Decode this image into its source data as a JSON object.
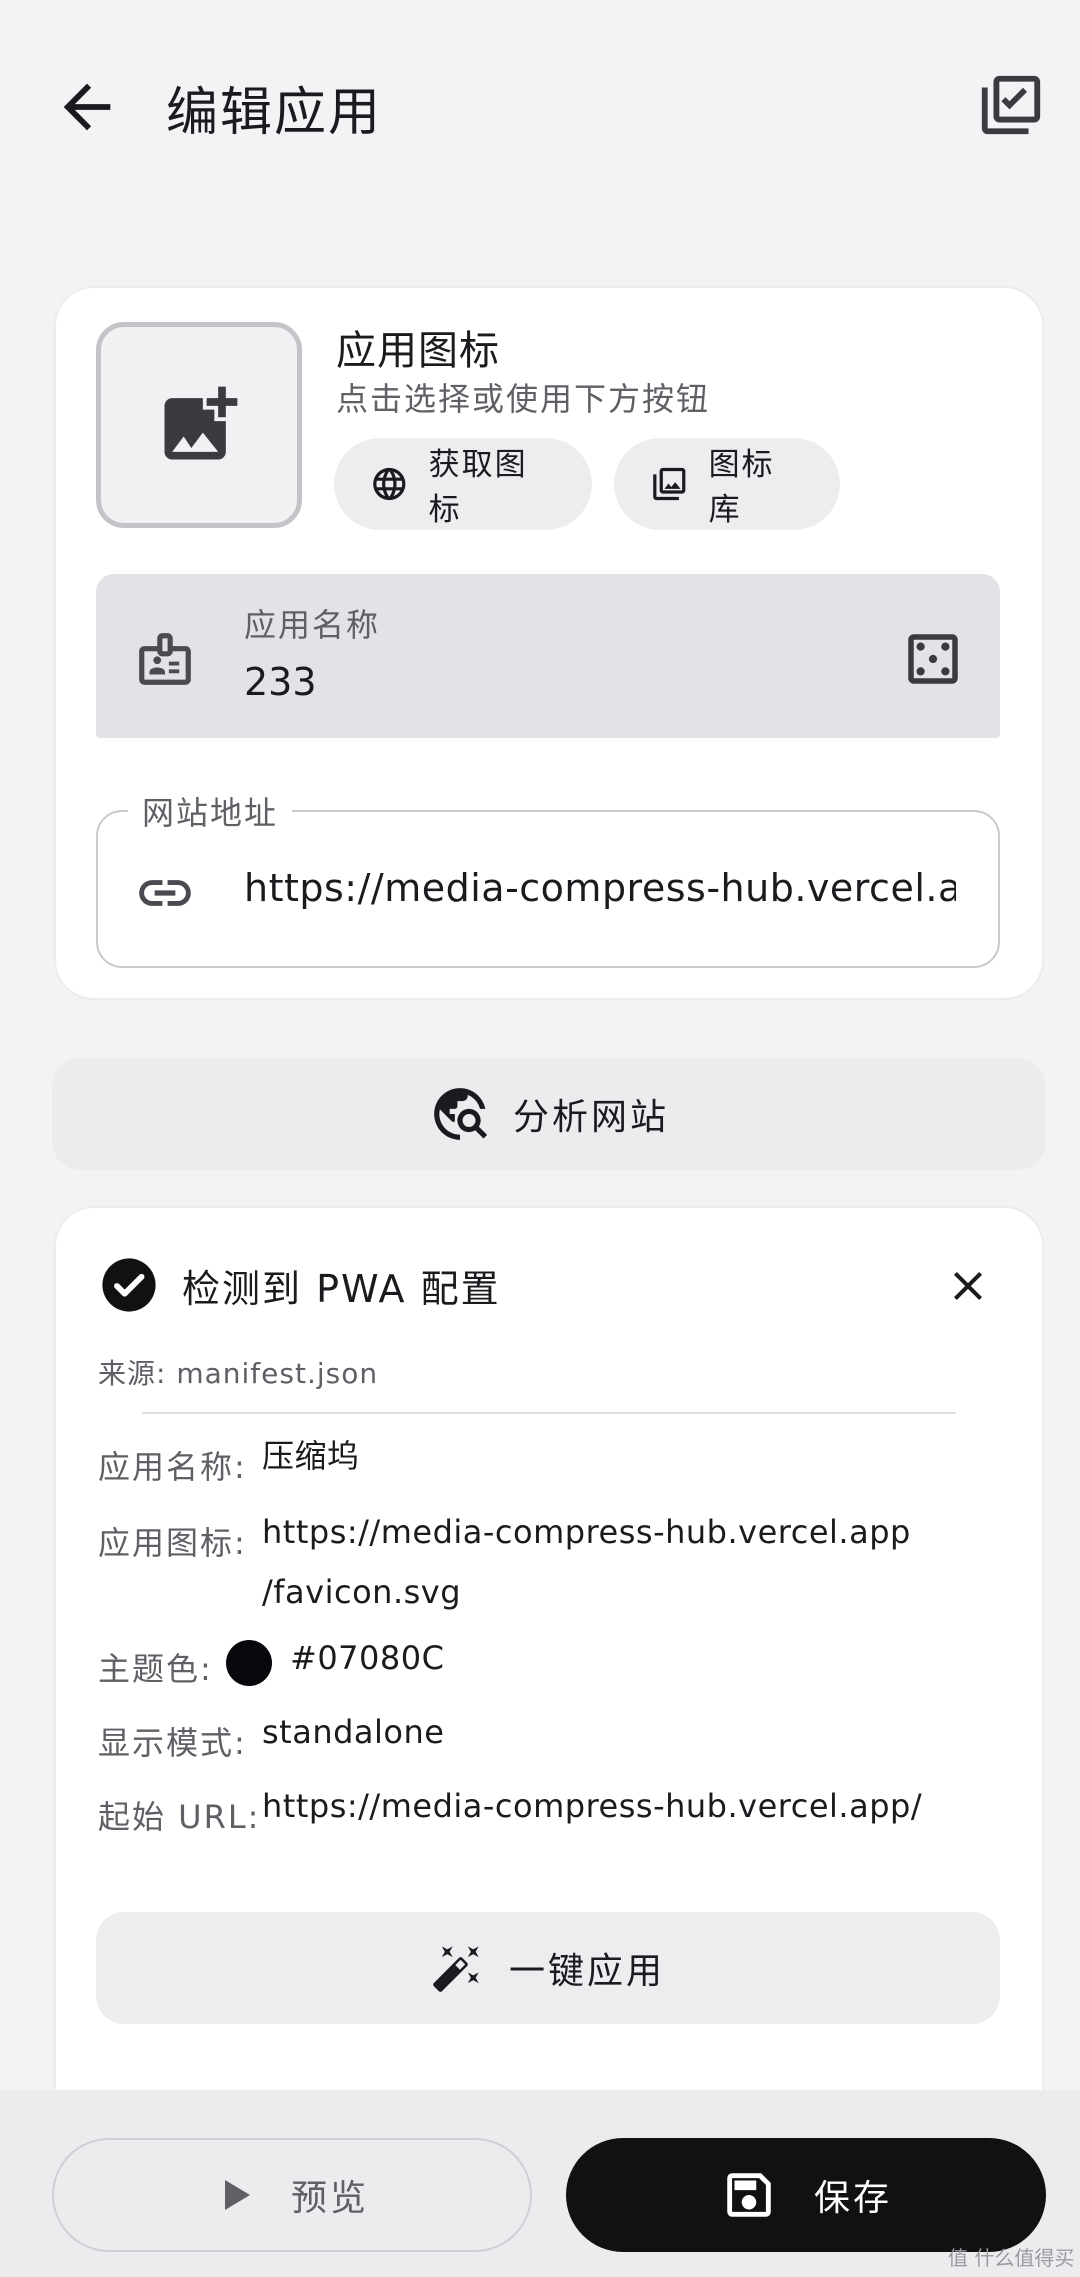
{
  "header": {
    "title": "编辑应用"
  },
  "icon_section": {
    "title": "应用图标",
    "subtitle": "点击选择或使用下方按钮",
    "fetch_label": "获取图标",
    "library_label": "图标库"
  },
  "name_field": {
    "label": "应用名称",
    "value": "233"
  },
  "url_field": {
    "label": "网站地址",
    "value": "https://media-compress-hub.vercel.app"
  },
  "analyze": {
    "label": "分析网站"
  },
  "pwa": {
    "title": "检测到 PWA 配置",
    "source": "来源: manifest.json",
    "rows": [
      {
        "label": "应用名称:",
        "value": "压缩坞"
      },
      {
        "label": "应用图标:",
        "value": "https://media-compress-hub.vercel.app",
        "value2": "/favicon.svg"
      },
      {
        "label": "主题色:",
        "value": "#07080C"
      },
      {
        "label": "显示模式:",
        "value": "standalone"
      },
      {
        "label": "起始 URL:",
        "value": "https://media-compress-hub.vercel.app/"
      }
    ],
    "theme_color": "#07080C",
    "apply_label": "一键应用"
  },
  "footer": {
    "preview_label": "预览",
    "save_label": "保存"
  },
  "watermark": "值 什么值得买",
  "colors": {
    "background": "#f3f3f5",
    "card": "#ffffff",
    "field": "#e3e3e7",
    "primary_button": "#111111"
  }
}
